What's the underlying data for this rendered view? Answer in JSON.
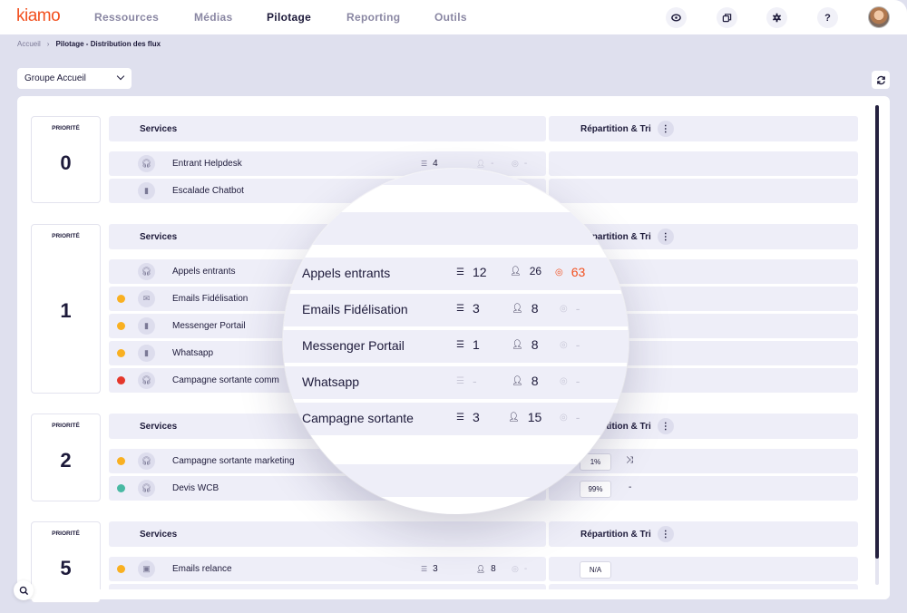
{
  "app": {
    "logo": "kiamo"
  },
  "nav": {
    "items": [
      {
        "label": "Ressources",
        "active": false
      },
      {
        "label": "Médias",
        "active": false
      },
      {
        "label": "Pilotage",
        "active": true
      },
      {
        "label": "Reporting",
        "active": false
      },
      {
        "label": "Outils",
        "active": false
      }
    ],
    "icons": [
      "eye-icon",
      "windows-icon",
      "gear-icon",
      "help-icon"
    ],
    "help_glyph": "?"
  },
  "breadcrumb": {
    "home": "Accueil",
    "separator": "›",
    "current": "Pilotage - Distribution des flux"
  },
  "toolbar": {
    "group_select": "Groupe Accueil"
  },
  "headers": {
    "priority": "PRIORITÉ",
    "services": "Services",
    "repartition": "Répartition & Tri"
  },
  "colors": {
    "accent": "#f2501f",
    "dot_orange": "#f9b021",
    "dot_red": "#e5372b",
    "dot_teal": "#49b9a3",
    "dark": "#1d1a3a"
  },
  "priorities": [
    {
      "priority": "0",
      "services": [
        {
          "name": "Entrant Helpdesk",
          "status": null,
          "icon": "headset",
          "queue": "4",
          "agents": "-",
          "sla": "-"
        },
        {
          "name": "Escalade Chatbot",
          "status": null,
          "icon": "phone",
          "queue": "",
          "agents": "",
          "sla": ""
        }
      ]
    },
    {
      "priority": "1",
      "services": [
        {
          "name": "Appels entrants",
          "status": null,
          "icon": "headset"
        },
        {
          "name": "Emails Fidélisation",
          "status": "orange",
          "icon": "mail"
        },
        {
          "name": "Messenger Portail",
          "status": "orange",
          "icon": "phone"
        },
        {
          "name": "Whatsapp",
          "status": "orange",
          "icon": "phone"
        },
        {
          "name": "Campagne sortante comm",
          "status": "red",
          "icon": "headset"
        }
      ]
    },
    {
      "priority": "2",
      "services": [
        {
          "name": "Campagne sortante marketing",
          "status": "orange",
          "icon": "headset",
          "share": "1%",
          "sort": "shuffle"
        },
        {
          "name": "Devis WCB",
          "status": "teal",
          "icon": "headset",
          "share": "99%",
          "sort": "-"
        }
      ]
    },
    {
      "priority": "5",
      "services": [
        {
          "name": "Emails relance",
          "status": "orange",
          "icon": "folder-plus",
          "queue": "3",
          "agents": "8",
          "sla": "-",
          "share": "N/A"
        }
      ]
    }
  ],
  "magnifier": {
    "rows": [
      {
        "name": "Appels entrants",
        "queue": "12",
        "agents": "26",
        "sla": "63",
        "sla_alert": true,
        "queue_muted": false
      },
      {
        "name": "Emails Fidélisation",
        "queue": "3",
        "agents": "8",
        "sla": "-",
        "sla_alert": false,
        "queue_muted": false
      },
      {
        "name": "Messenger Portail",
        "queue": "1",
        "agents": "8",
        "sla": "-",
        "sla_alert": false,
        "queue_muted": false
      },
      {
        "name": "Whatsapp",
        "queue": "-",
        "agents": "8",
        "sla": "-",
        "sla_alert": false,
        "queue_muted": true
      },
      {
        "name": "Campagne sortante",
        "queue": "3",
        "agents": "15",
        "sla": "-",
        "sla_alert": false,
        "queue_muted": false
      }
    ]
  }
}
